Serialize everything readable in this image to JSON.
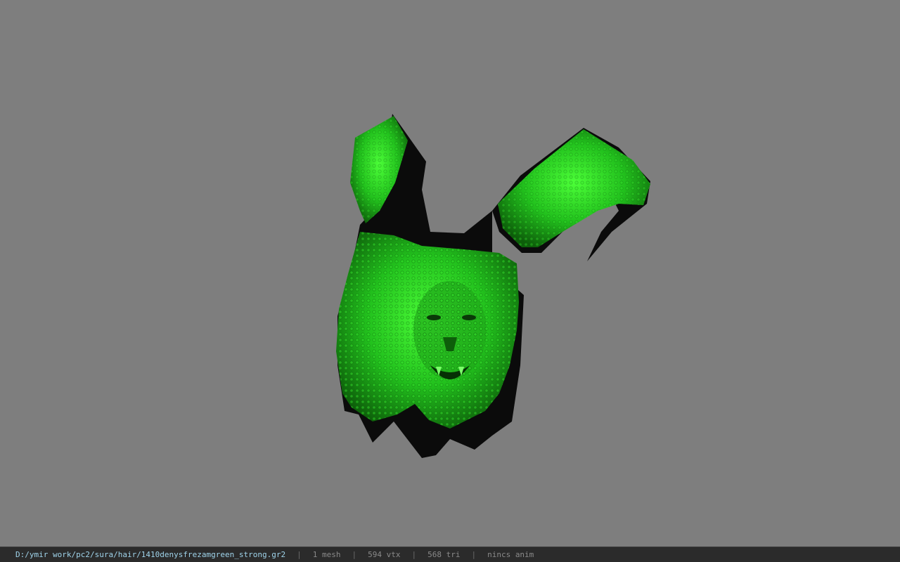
{
  "viewport": {
    "background_color": "#7e7e7e",
    "model_name": "lion-head-hair-model",
    "model_primary_color": "#2fd42a",
    "model_shadow_color": "#0b0b0b"
  },
  "statusbar": {
    "path": "D:/ymir work/pc2/sura/hair/1410denysfrezamgreen_strong.gr2",
    "separator": "|",
    "mesh": "1 mesh",
    "vertices": "594 vtx",
    "triangles": "568 tri",
    "anim": "nincs anim"
  }
}
